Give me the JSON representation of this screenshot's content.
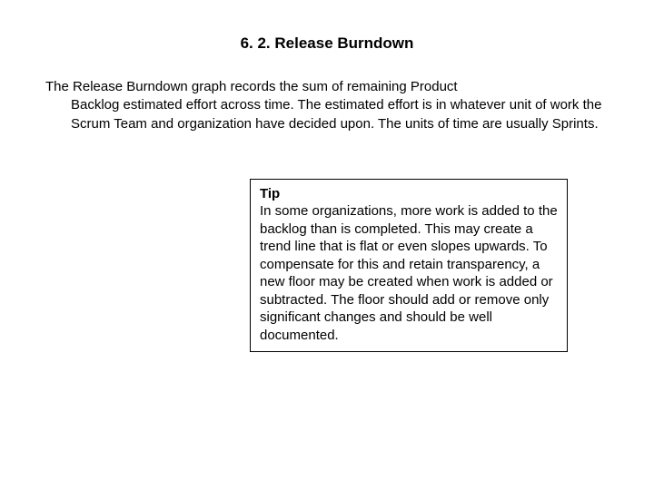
{
  "heading": "6. 2. Release Burndown",
  "paragraph_first": "The Release Burndown graph records the sum of remaining Product",
  "paragraph_rest": "Backlog estimated effort across time. The estimated effort is in whatever unit of work the Scrum Team and organization have decided upon. The units of time are usually Sprints.",
  "tip": {
    "label": "Tip",
    "body": "In some organizations, more work is added to the backlog than is completed. This may create a trend line that is flat or even slopes upwards. To compensate for this and retain transparency, a new floor may be created when work is added or subtracted. The floor should add or remove only significant changes and should be well documented."
  }
}
